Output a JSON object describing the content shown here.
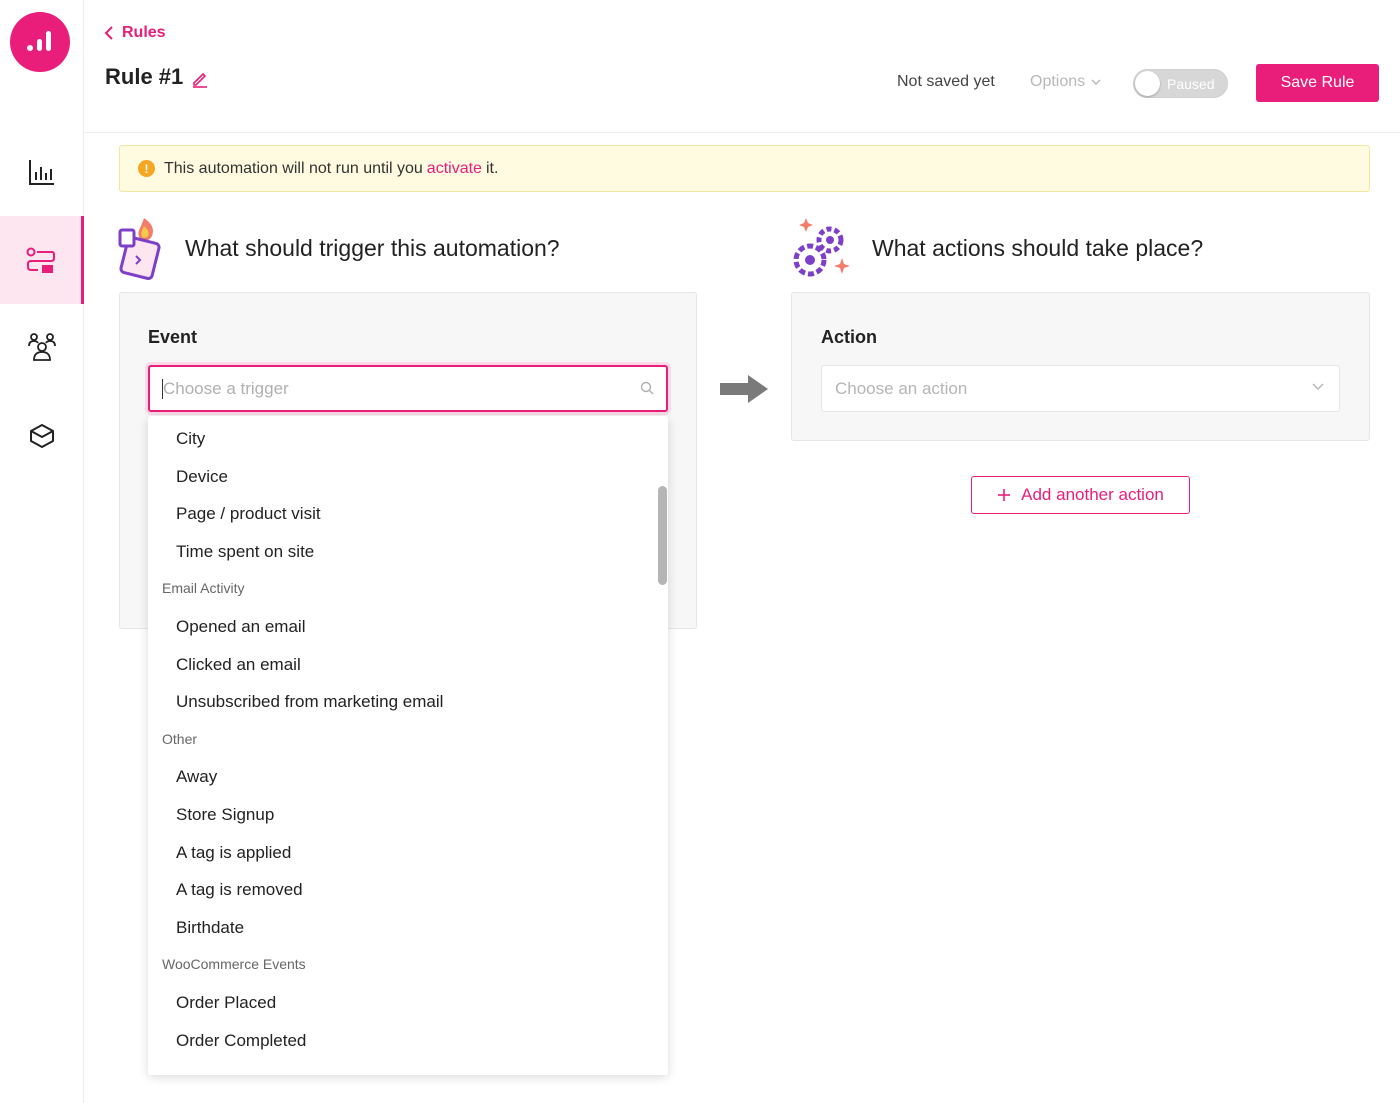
{
  "sidebar": {
    "items": [
      {
        "name": "reports",
        "icon": "bar-chart-icon",
        "active": false
      },
      {
        "name": "automation",
        "icon": "automation-icon",
        "active": true
      },
      {
        "name": "contacts",
        "icon": "people-icon",
        "active": false
      },
      {
        "name": "integrations",
        "icon": "box-icon",
        "active": false
      }
    ]
  },
  "header": {
    "back_label": "Rules",
    "title": "Rule #1",
    "status": "Not saved yet",
    "options_label": "Options",
    "toggle_label": "Paused",
    "save_label": "Save Rule"
  },
  "banner": {
    "before": "This automation will not run until you",
    "link": "activate",
    "after": "it."
  },
  "trigger": {
    "heading": "What should trigger this automation?",
    "card_label": "Event",
    "placeholder": "Choose a trigger"
  },
  "actions": {
    "heading": "What actions should take place?",
    "card_label": "Action",
    "placeholder": "Choose an action",
    "add_label": "Add another action"
  },
  "dropdown": {
    "rows": [
      {
        "type": "item",
        "label": "City"
      },
      {
        "type": "item",
        "label": "Device"
      },
      {
        "type": "item",
        "label": "Page / product visit"
      },
      {
        "type": "item",
        "label": "Time spent on site"
      },
      {
        "type": "group",
        "label": "Email Activity"
      },
      {
        "type": "item",
        "label": "Opened an email"
      },
      {
        "type": "item",
        "label": "Clicked an email"
      },
      {
        "type": "item",
        "label": "Unsubscribed from marketing email"
      },
      {
        "type": "group",
        "label": "Other"
      },
      {
        "type": "item",
        "label": "Away"
      },
      {
        "type": "item",
        "label": "Store Signup"
      },
      {
        "type": "item",
        "label": "A tag is applied"
      },
      {
        "type": "item",
        "label": "A tag is removed"
      },
      {
        "type": "item",
        "label": "Birthdate"
      },
      {
        "type": "group",
        "label": "WooCommerce Events"
      },
      {
        "type": "item",
        "label": "Order Placed"
      },
      {
        "type": "item",
        "label": "Order Completed"
      }
    ]
  },
  "colors": {
    "accent": "#e91e7b",
    "banner_bg": "#fffbe0",
    "warning": "#f5a623"
  }
}
